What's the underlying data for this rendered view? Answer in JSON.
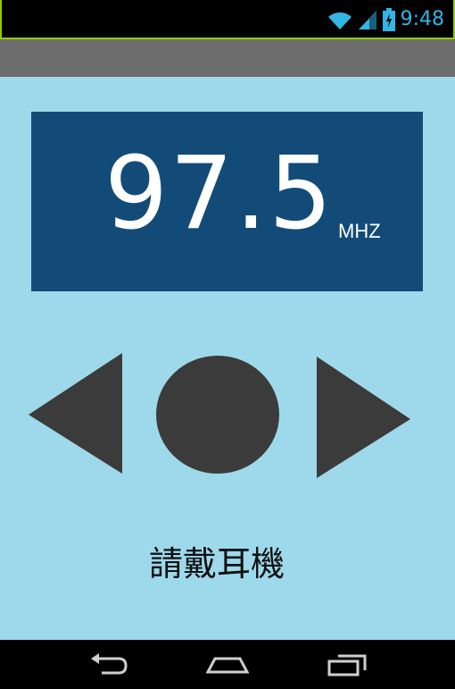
{
  "status_bar": {
    "time": "9:48",
    "icons": [
      "wifi-icon",
      "cellular-signal-icon",
      "battery-charging-icon"
    ],
    "accent_color": "#33b5e5"
  },
  "radio": {
    "frequency": "97.5",
    "unit": "MHZ"
  },
  "controls": {
    "icons": [
      "previous-triangle-icon",
      "play-circle-icon",
      "next-triangle-icon"
    ]
  },
  "message": {
    "text": "請戴耳機"
  },
  "nav_bar": {
    "icons": [
      "back-icon",
      "home-icon",
      "recent-apps-icon"
    ]
  },
  "colors": {
    "background": "#9dd9eb",
    "panel": "#134b78",
    "action_bar": "#6d6d6d",
    "controls": "#3b3b3b"
  }
}
